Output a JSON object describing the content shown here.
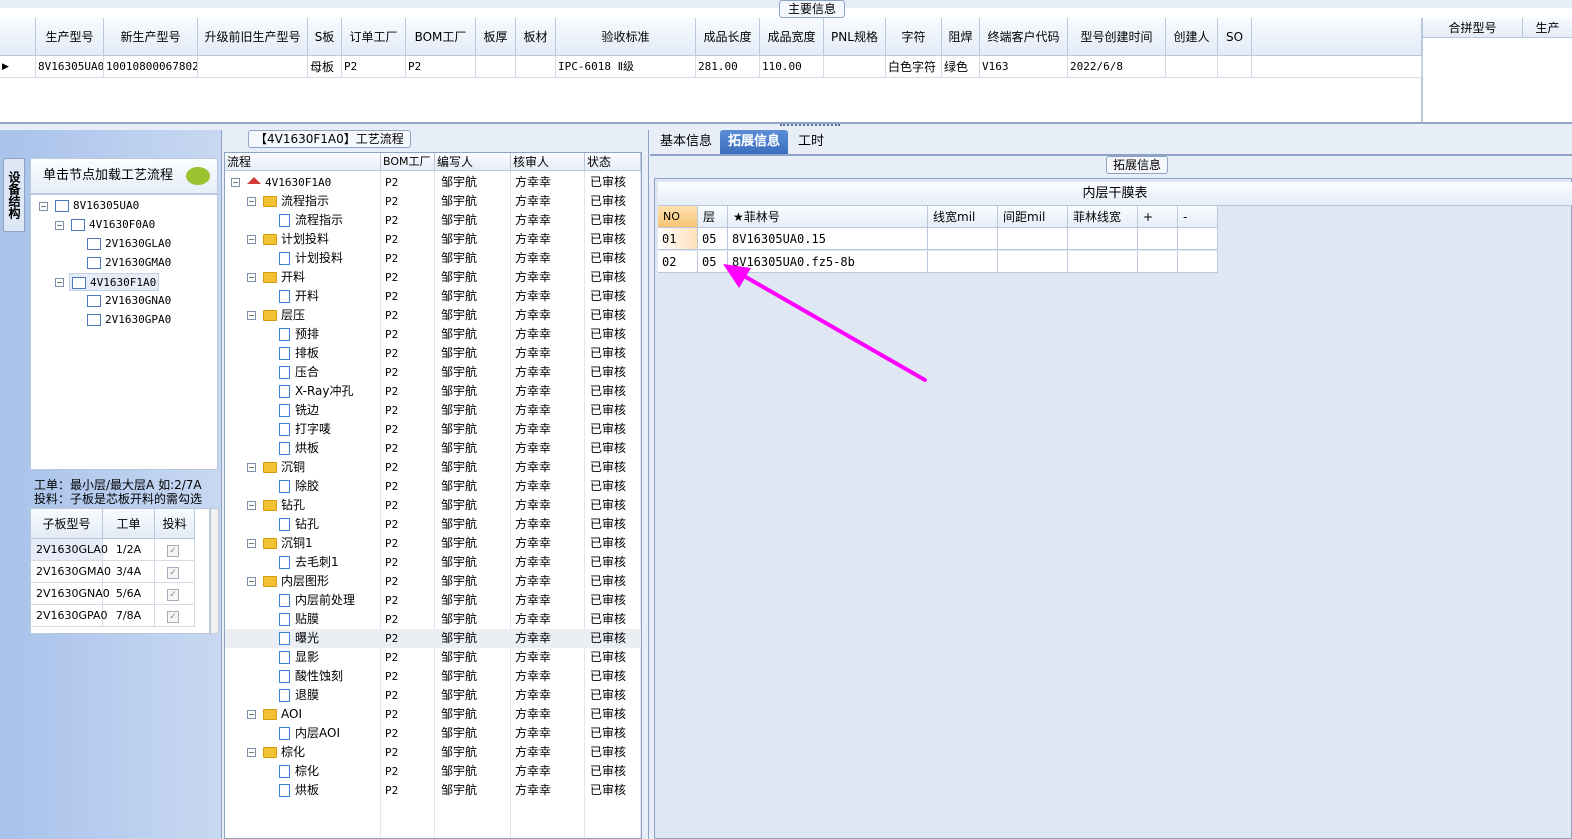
{
  "top": {
    "caption": "主要信息",
    "columns": [
      "生产型号",
      "新生产型号",
      "升级前旧生产型号",
      "S板",
      "订单工厂",
      "BOM工厂",
      "板厚",
      "板材",
      "验收标准",
      "成品长度",
      "成品宽度",
      "PNL规格",
      "字符",
      "阻焊",
      "终端客户代码",
      "型号创建时间",
      "创建人",
      "SO"
    ],
    "row": [
      "8V16305UA0",
      "10010800067802",
      "",
      "母板",
      "P2",
      "P2",
      "",
      "",
      "IPC-6018 Ⅱ级",
      "281.00",
      "110.00",
      "",
      "白色字符",
      "绿色",
      "V163",
      "2022/6/8",
      "",
      ""
    ],
    "right_columns": [
      "合拼型号",
      "生产"
    ]
  },
  "left": {
    "side_tab": "设备结构",
    "tree_header": "单击节点加载工艺流程",
    "tree": [
      {
        "label": "8V16305UA0"
      },
      {
        "label": "4V1630F0A0"
      },
      {
        "label": "2V1630GLA0"
      },
      {
        "label": "2V1630GMA0"
      },
      {
        "label": "4V1630F1A0"
      },
      {
        "label": "2V1630GNA0"
      },
      {
        "label": "2V1630GPA0"
      }
    ],
    "notes": [
      "工单：最小层/最大层A 如:2/7A",
      "投料：子板是芯板开料的需勾选"
    ],
    "sub_table": {
      "columns": [
        "子板型号",
        "工单",
        "投料"
      ],
      "rows": [
        [
          "2V1630GLA0",
          "1/2A"
        ],
        [
          "2V1630GMA0",
          "3/4A"
        ],
        [
          "2V1630GNA0",
          "5/6A"
        ],
        [
          "2V1630GPA0",
          "7/8A"
        ]
      ]
    }
  },
  "process": {
    "caption": "【4V1630F1A0】工艺流程",
    "columns": [
      "流程",
      "BOM工厂",
      "编写人",
      "核审人",
      "状态"
    ],
    "root": "4V1630F1A0",
    "rows": [
      {
        "label": "流程指示",
        "folder": true
      },
      {
        "label": "流程指示",
        "folder": false
      },
      {
        "label": "计划投料",
        "folder": true
      },
      {
        "label": "计划投料",
        "folder": false
      },
      {
        "label": "开料",
        "folder": true
      },
      {
        "label": "开料",
        "folder": false
      },
      {
        "label": "层压",
        "folder": true
      },
      {
        "label": "预排",
        "folder": false
      },
      {
        "label": "排板",
        "folder": false
      },
      {
        "label": "压合",
        "folder": false
      },
      {
        "label": "X-Ray冲孔",
        "folder": false
      },
      {
        "label": "铣边",
        "folder": false
      },
      {
        "label": "打字唛",
        "folder": false
      },
      {
        "label": "烘板",
        "folder": false
      },
      {
        "label": "沉铜",
        "folder": true
      },
      {
        "label": "除胶",
        "folder": false
      },
      {
        "label": "钻孔",
        "folder": true
      },
      {
        "label": "钻孔",
        "folder": false
      },
      {
        "label": "沉铜1",
        "folder": true
      },
      {
        "label": "去毛刺1",
        "folder": false
      },
      {
        "label": "内层图形",
        "folder": true
      },
      {
        "label": "内层前处理",
        "folder": false
      },
      {
        "label": "贴膜",
        "folder": false
      },
      {
        "label": "曝光",
        "folder": false
      },
      {
        "label": "显影",
        "folder": false
      },
      {
        "label": "酸性蚀刻",
        "folder": false
      },
      {
        "label": "退膜",
        "folder": false
      },
      {
        "label": "AOI",
        "folder": true
      },
      {
        "label": "内层AOI",
        "folder": false
      },
      {
        "label": "棕化",
        "folder": true
      },
      {
        "label": "棕化",
        "folder": false
      },
      {
        "label": "烘板",
        "folder": false
      }
    ],
    "bom": "P2",
    "writer": "邹宇航",
    "reviewer": "方幸幸",
    "status": "已审核"
  },
  "right": {
    "tabs": [
      "基本信息",
      "拓展信息",
      "工时"
    ],
    "caption": "拓展信息",
    "table_title": "内层干膜表",
    "columns": [
      "NO",
      "层",
      "★菲林号",
      "线宽mil",
      "间距mil",
      "菲林线宽",
      "+",
      "-"
    ],
    "rows": [
      [
        "01",
        "05",
        "8V16305UA0.15",
        "",
        "",
        "",
        "",
        ""
      ],
      [
        "02",
        "05",
        "8V16305UA0.fz5-8b",
        "",
        "",
        "",
        "",
        ""
      ]
    ]
  },
  "colors": {
    "accent": "#3a6fbf",
    "arrow": "#ff00ff",
    "folder": "#f3c233"
  }
}
